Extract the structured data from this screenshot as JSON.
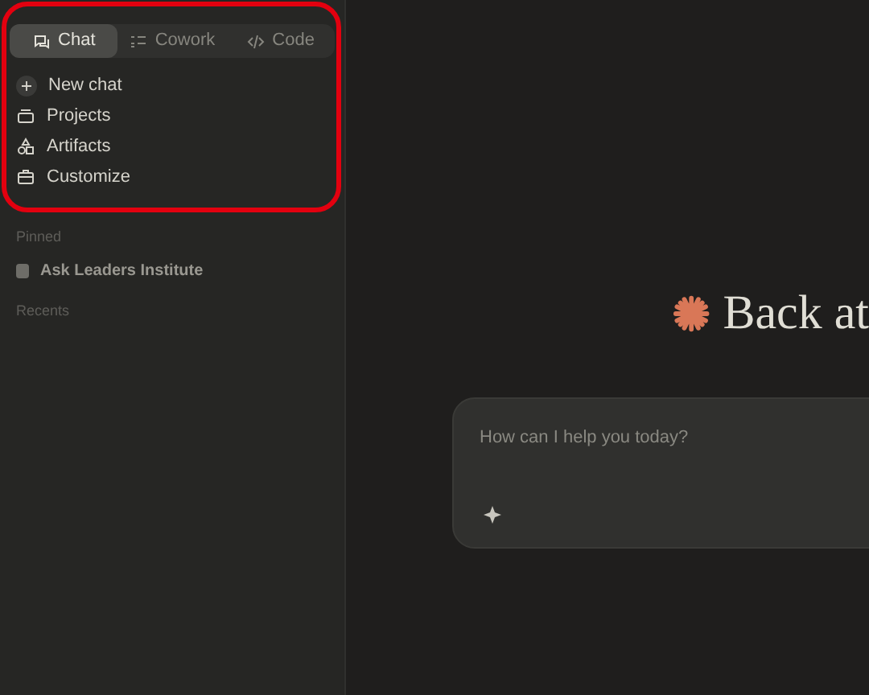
{
  "tabs": [
    {
      "label": "Chat",
      "kind": "chat",
      "selected": true
    },
    {
      "label": "Cowork",
      "kind": "list",
      "selected": false
    },
    {
      "label": "Code",
      "kind": "code",
      "selected": false
    }
  ],
  "nav": [
    {
      "label": "New chat",
      "kind": "plus"
    },
    {
      "label": "Projects",
      "kind": "box"
    },
    {
      "label": "Artifacts",
      "kind": "shapes"
    },
    {
      "label": "Customize",
      "kind": "briefcase"
    }
  ],
  "pinned": {
    "heading": "Pinned",
    "items": [
      {
        "label": "Ask Leaders Institute"
      }
    ]
  },
  "recents": {
    "heading": "Recents"
  },
  "greeting": "Back at",
  "composer": {
    "placeholder": "How can I help you today?"
  }
}
